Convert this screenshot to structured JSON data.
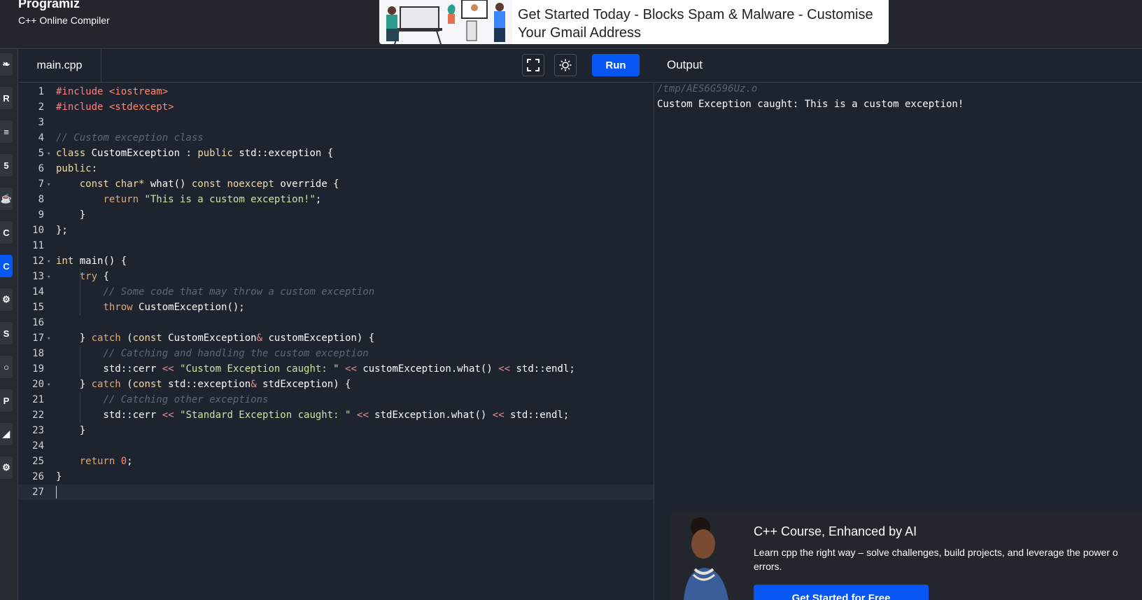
{
  "header": {
    "brand_name": "Programiz",
    "brand_sub": "C++ Online Compiler",
    "ad_text": "Get Started Today - Blocks Spam & Malware - Customise Your Gmail Address"
  },
  "editor": {
    "file_tab": "main.cpp",
    "run_label": "Run",
    "lines": [
      [
        [
          "inc",
          "#include "
        ],
        [
          "n",
          "<iostream>"
        ]
      ],
      [
        [
          "inc",
          "#include "
        ],
        [
          "n",
          "<stdexcept>"
        ]
      ],
      [],
      [
        [
          "c",
          "// Custom exception class"
        ]
      ],
      [
        [
          "k",
          "class"
        ],
        [
          "p",
          " CustomException : "
        ],
        [
          "k",
          "public"
        ],
        [
          "p",
          " std::exception {"
        ]
      ],
      [
        [
          "k",
          "public"
        ],
        [
          "p",
          ":"
        ]
      ],
      [
        [
          "p",
          "    "
        ],
        [
          "k",
          "const char*"
        ],
        [
          "p",
          " what() "
        ],
        [
          "k",
          "const noexcept"
        ],
        [
          "p",
          " override {"
        ]
      ],
      [
        [
          "p",
          "        "
        ],
        [
          "kr",
          "return"
        ],
        [
          "p",
          " "
        ],
        [
          "s",
          "\"This is a custom exception!\""
        ],
        [
          "p",
          ";"
        ]
      ],
      [
        [
          "p",
          "    }"
        ]
      ],
      [
        [
          "p",
          "};"
        ]
      ],
      [],
      [
        [
          "k",
          "int"
        ],
        [
          "p",
          " main() {"
        ]
      ],
      [
        [
          "p",
          "    "
        ],
        [
          "kr",
          "try"
        ],
        [
          "p",
          " {"
        ]
      ],
      [
        [
          "p",
          "        "
        ],
        [
          "c",
          "// Some code that may throw a custom exception"
        ]
      ],
      [
        [
          "p",
          "        "
        ],
        [
          "kr",
          "throw"
        ],
        [
          "p",
          " CustomException();"
        ]
      ],
      [],
      [
        [
          "p",
          "    } "
        ],
        [
          "kr",
          "catch"
        ],
        [
          "p",
          " ("
        ],
        [
          "k",
          "const"
        ],
        [
          "p",
          " CustomException"
        ],
        [
          "o",
          "&"
        ],
        [
          "p",
          " customException) {"
        ]
      ],
      [
        [
          "p",
          "        "
        ],
        [
          "c",
          "// Catching and handling the custom exception"
        ]
      ],
      [
        [
          "p",
          "        std::cerr "
        ],
        [
          "o",
          "<<"
        ],
        [
          "p",
          " "
        ],
        [
          "s",
          "\"Custom Exception caught: \""
        ],
        [
          "p",
          " "
        ],
        [
          "o",
          "<<"
        ],
        [
          "p",
          " customException.what() "
        ],
        [
          "o",
          "<<"
        ],
        [
          "p",
          " std::endl;"
        ]
      ],
      [
        [
          "p",
          "    } "
        ],
        [
          "kr",
          "catch"
        ],
        [
          "p",
          " ("
        ],
        [
          "k",
          "const"
        ],
        [
          "p",
          " std::exception"
        ],
        [
          "o",
          "&"
        ],
        [
          "p",
          " stdException) {"
        ]
      ],
      [
        [
          "p",
          "        "
        ],
        [
          "c",
          "// Catching other exceptions"
        ]
      ],
      [
        [
          "p",
          "        std::cerr "
        ],
        [
          "o",
          "<<"
        ],
        [
          "p",
          " "
        ],
        [
          "s",
          "\"Standard Exception caught: \""
        ],
        [
          "p",
          " "
        ],
        [
          "o",
          "<<"
        ],
        [
          "p",
          " stdException.what() "
        ],
        [
          "o",
          "<<"
        ],
        [
          "p",
          " std::endl;"
        ]
      ],
      [
        [
          "p",
          "    }"
        ]
      ],
      [],
      [
        [
          "p",
          "    "
        ],
        [
          "kr",
          "return"
        ],
        [
          "p",
          " "
        ],
        [
          "n",
          "0"
        ],
        [
          "p",
          ";"
        ]
      ],
      [
        [
          "p",
          "}"
        ]
      ],
      []
    ],
    "fold_lines": [
      5,
      7,
      12,
      13,
      17,
      20
    ],
    "current_line": 27
  },
  "output": {
    "title": "Output",
    "path": "/tmp/AES6G596Uz.o",
    "text": "Custom Exception caught: This is a custom exception!"
  },
  "promo": {
    "title": "C++ Course, Enhanced by AI",
    "desc_line1": "Learn cpp the right way – solve challenges, build projects, and leverage the power o",
    "desc_line2": "errors.",
    "button": "Get Started for Free"
  },
  "rail": {
    "items": [
      "python-icon",
      "r-icon",
      "sql-icon",
      "html-icon",
      "java-icon",
      "c-icon",
      "cpp-icon",
      "csharp-icon",
      "js-icon",
      "go-icon",
      "php-icon",
      "swift-icon",
      "rust-icon"
    ],
    "active_index": 6
  }
}
